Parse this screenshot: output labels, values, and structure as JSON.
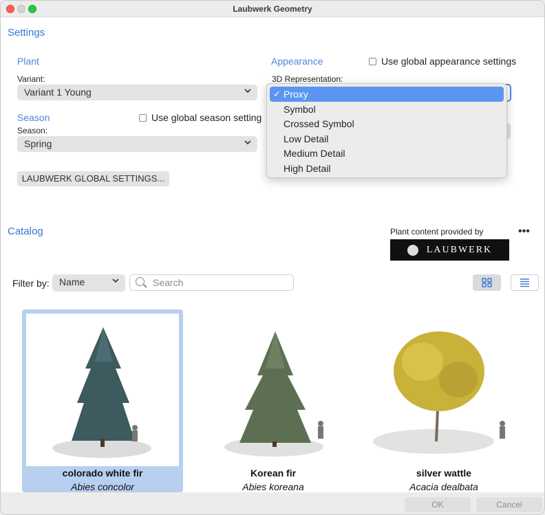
{
  "window": {
    "title": "Laubwerk Geometry"
  },
  "settings": {
    "title": "Settings",
    "plant": {
      "title": "Plant",
      "variant_label": "Variant:",
      "variant_value": "Variant 1 Young"
    },
    "season": {
      "title": "Season",
      "use_global_label": "Use global season setting",
      "season_label": "Season:",
      "season_value": "Spring"
    },
    "global_button": "LAUBWERK GLOBAL SETTINGS...",
    "appearance": {
      "title": "Appearance",
      "use_global_label": "Use global appearance settings",
      "rep_label": "3D Representation:",
      "rep_selected": "Proxy",
      "rep_options": [
        "Proxy",
        "Symbol",
        "Crossed Symbol",
        "Low Detail",
        "Medium Detail",
        "High Detail"
      ]
    }
  },
  "catalog": {
    "title": "Catalog",
    "provided_by": "Plant content provided by",
    "logo_text": "LAUBWERK",
    "filter_label": "Filter by:",
    "filter_value": "Name",
    "search_placeholder": "Search",
    "items": [
      {
        "name": "colorado white fir",
        "scientific": "Abies concolor",
        "selected": true
      },
      {
        "name": "Korean fir",
        "scientific": "Abies koreana",
        "selected": false
      },
      {
        "name": "silver wattle",
        "scientific": "Acacia dealbata",
        "selected": false
      }
    ]
  },
  "footer": {
    "ok": "OK",
    "cancel": "Cancel"
  },
  "colors": {
    "accent": "#3476d6",
    "selection": "#5b95f0",
    "card_selected": "#b8cff0"
  }
}
